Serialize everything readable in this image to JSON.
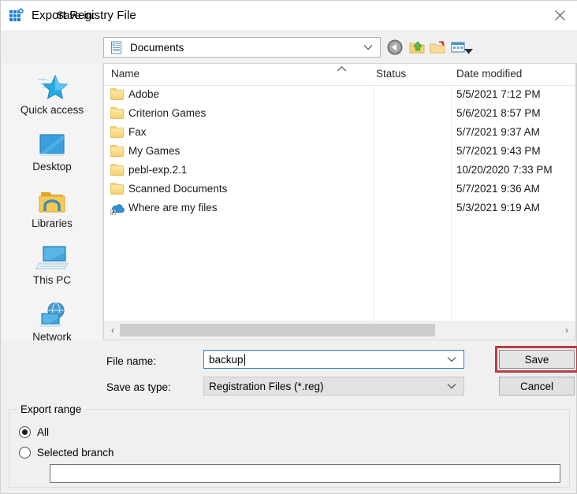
{
  "window": {
    "title": "Export Registry File",
    "app_icon": "registry-editor-icon",
    "close_label": "×"
  },
  "toolbar": {
    "save_in_label": "Save in:",
    "current_folder": "Documents",
    "current_folder_icon": "documents-folder-icon",
    "dropdown_arrow": "chevron-down-icon",
    "buttons": [
      {
        "name": "back-button",
        "icon": "back-arrow-icon"
      },
      {
        "name": "up-one-level-button",
        "icon": "up-folder-icon"
      },
      {
        "name": "new-folder-button",
        "icon": "new-folder-icon"
      },
      {
        "name": "views-button",
        "icon": "views-icon"
      }
    ],
    "views_arrow": "chevron-down-icon"
  },
  "sidebar": {
    "items": [
      {
        "label": "Quick access",
        "icon": "star-icon"
      },
      {
        "label": "Desktop",
        "icon": "monitor-icon"
      },
      {
        "label": "Libraries",
        "icon": "libraries-folder-icon"
      },
      {
        "label": "This PC",
        "icon": "computer-icon"
      },
      {
        "label": "Network",
        "icon": "network-globe-icon"
      }
    ]
  },
  "file_list": {
    "columns": [
      "Name",
      "Status",
      "Date modified"
    ],
    "sort_indicator": "sort-ascending-caret",
    "rows": [
      {
        "name": "Adobe",
        "icon": "folder-icon",
        "status": "",
        "date_modified": "5/5/2021 7:12 PM"
      },
      {
        "name": "Criterion Games",
        "icon": "folder-icon",
        "status": "",
        "date_modified": "5/6/2021 8:57 PM"
      },
      {
        "name": "Fax",
        "icon": "folder-icon",
        "status": "",
        "date_modified": "5/7/2021 9:37 AM"
      },
      {
        "name": "My Games",
        "icon": "folder-icon",
        "status": "",
        "date_modified": "5/7/2021 9:43 PM"
      },
      {
        "name": "pebl-exp.2.1",
        "icon": "folder-icon",
        "status": "",
        "date_modified": "10/20/2020 7:33 PM"
      },
      {
        "name": "Scanned Documents",
        "icon": "folder-icon",
        "status": "",
        "date_modified": "5/7/2021 9:36 AM"
      },
      {
        "name": "Where are my files",
        "icon": "onedrive-shortcut-icon",
        "status": "",
        "date_modified": "5/3/2021 9:19 AM"
      }
    ],
    "scrollbar": {
      "left_arrow": "‹",
      "right_arrow": "›"
    }
  },
  "form": {
    "file_name_label": "File name:",
    "file_name_value": "backup",
    "file_name_placeholder": "",
    "save_as_type_label": "Save as type:",
    "save_as_type_value": "Registration Files (*.reg)",
    "save_button": "Save",
    "cancel_button": "Cancel"
  },
  "export_range": {
    "title": "Export range",
    "options": [
      {
        "label": "All",
        "selected": true
      },
      {
        "label": "Selected branch",
        "selected": false
      }
    ],
    "branch_value": "",
    "branch_placeholder": ""
  },
  "colors": {
    "highlight_red": "#bb3b44",
    "focus_blue": "#2a7fd4",
    "window_bg": "#f0f0f0",
    "panel_bg": "#ffffff"
  }
}
